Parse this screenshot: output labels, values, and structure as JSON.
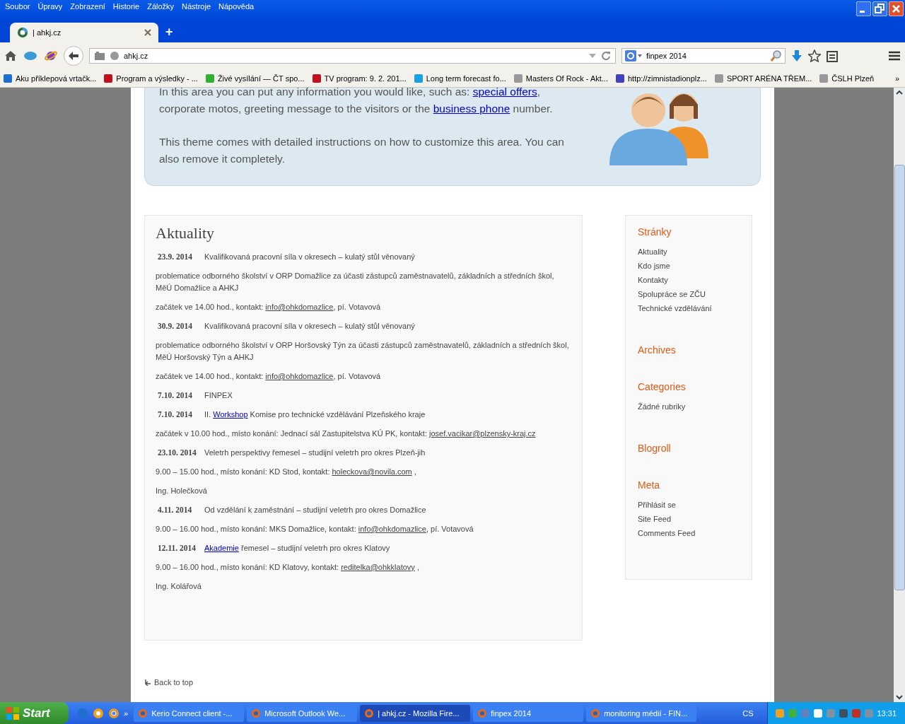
{
  "window": {
    "menu": [
      "Soubor",
      "Úpravy",
      "Zobrazení",
      "Historie",
      "Záložky",
      "Nástroje",
      "Nápověda"
    ]
  },
  "tabs": [
    {
      "title": "| ahkj.cz",
      "selected": true
    }
  ],
  "new_tab": "+",
  "address_bar": {
    "url": "ahkj.cz"
  },
  "search": {
    "value": "finpex 2014"
  },
  "bookmarks": [
    "Aku příklepová vrtačk...",
    "Program a výsledky - ...",
    "Živé vysílání — ČT spo...",
    "TV program: 9. 2. 201...",
    "Long term forecast fo...",
    "Masters Of Rock - Akt...",
    "http://zimnistadionplz...",
    "SPORT ARÉNA TŘEM...",
    "ČSLH Plzeň"
  ],
  "bookmarks_more": "»",
  "info_box": {
    "paragraphs": [
      [
        {
          "kind": "text",
          "text": "In this area you can put any information you would like, such as: "
        },
        {
          "kind": "link",
          "text": "special offers"
        },
        {
          "kind": "text",
          "text": ", corporate motos, greeting message to the visitors or the "
        },
        {
          "kind": "link",
          "text": "business phone"
        },
        {
          "kind": "text",
          "text": " number."
        }
      ],
      [
        {
          "kind": "text",
          "text": "This theme comes with detailed instructions on how to customize this area. You can also remove it completely."
        }
      ]
    ]
  },
  "news": {
    "title": "Aktuality",
    "lines": [
      [
        {
          "kind": "date",
          "text": "23.9. 2014"
        },
        {
          "kind": "text",
          "text": "Kvalifikovaná pracovní síla v okresech – kulatý stůl věnovaný"
        }
      ],
      [
        {
          "kind": "text",
          "text": "problematice odborného školství v ORP Domažlice za účasti zástupců zaměstnavatelů, základních a středních škol, MěÚ Domažlice a AHKJ"
        }
      ],
      [
        {
          "kind": "text",
          "text": "začátek ve 14.00 hod., kontakt: "
        },
        {
          "kind": "email",
          "text": "info@ohkdomazlice"
        },
        {
          "kind": "text",
          "text": ", pí. Votavová"
        }
      ],
      [
        {
          "kind": "date",
          "text": "30.9. 2014"
        },
        {
          "kind": "text",
          "text": "Kvalifikovaná pracovní síla v okresech – kulatý stůl věnovaný"
        }
      ],
      [
        {
          "kind": "text",
          "text": "problematice odborného školství v ORP Horšovský Týn za účasti zástupců zaměstnavatelů, základních a středních škol, MěÚ Horšovský Týn a AHKJ"
        }
      ],
      [
        {
          "kind": "text",
          "text": "začátek ve 14.00 hod., kontakt: "
        },
        {
          "kind": "email",
          "text": "info@ohkdomazlice"
        },
        {
          "kind": "text",
          "text": ", pí. Votavová"
        }
      ],
      [
        {
          "kind": "date",
          "text": "7.10. 2014"
        },
        {
          "kind": "text",
          "text": "FINPEX"
        }
      ],
      [
        {
          "kind": "date",
          "text": "7.10. 2014"
        },
        {
          "kind": "text",
          "text": "II. "
        },
        {
          "kind": "link",
          "text": "Workshop"
        },
        {
          "kind": "text",
          "text": " Komise pro technické vzdělávání Plzeňského kraje"
        }
      ],
      [
        {
          "kind": "text",
          "text": "začátek v 10.00 hod., místo konání: Jednací sál Zastupitelstva KÚ PK, kontakt: "
        },
        {
          "kind": "email",
          "text": "josef.vacikar@plzensky-kraj.cz"
        }
      ],
      [
        {
          "kind": "date",
          "text": "23.10. 2014"
        },
        {
          "kind": "text",
          "text": "Veletrh perspektivy řemesel – studijní veletrh pro okres Plzeň-jih"
        }
      ],
      [
        {
          "kind": "text",
          "text": "9.00 – 15.00 hod., místo konání: KD Stod, kontakt: "
        },
        {
          "kind": "email",
          "text": "holeckova@novila.com"
        },
        {
          "kind": "text",
          "text": " ,"
        }
      ],
      [
        {
          "kind": "text",
          "text": "Ing. Holečková"
        }
      ],
      [
        {
          "kind": "date",
          "text": "4.11. 2014"
        },
        {
          "kind": "text",
          "text": "Od vzdělání k zaměstnání – studijní veletrh pro okres Domažlice"
        }
      ],
      [
        {
          "kind": "text",
          "text": "9.00 – 16.00 hod., místo konání: MKS Domažlice, kontakt: "
        },
        {
          "kind": "email",
          "text": "info@ohkdomazlice"
        },
        {
          "kind": "text",
          "text": ", pí. Votavová"
        }
      ],
      [
        {
          "kind": "date",
          "text": "12.11. 2014"
        },
        {
          "kind": "link",
          "text": "Akademie"
        },
        {
          "kind": "text",
          "text": " řemesel – studijní veletrh pro okres Klatovy"
        }
      ],
      [
        {
          "kind": "text",
          "text": "9.00 – 16.00 hod., místo konání: KD Klatovy, kontakt: "
        },
        {
          "kind": "email",
          "text": "reditelka@ohkklatovy"
        },
        {
          "kind": "text",
          "text": " ,"
        }
      ],
      [
        {
          "kind": "text",
          "text": "Ing. Kolářová"
        }
      ]
    ]
  },
  "sidebar": [
    {
      "title": "Stránky",
      "items": [
        "Aktuality",
        "Kdo jsme",
        "Kontakty",
        "Spolupráce se ZČU",
        "Technické vzdělávání"
      ]
    },
    {
      "title": "Archives"
    },
    {
      "title": "Categories",
      "items": [
        "Žádné rubriky"
      ]
    },
    {
      "title": "Blogroll"
    },
    {
      "title": "Meta",
      "items": [
        "Přihlásit se",
        "Site Feed",
        "Comments Feed"
      ]
    }
  ],
  "back_to_top": "Back to top",
  "taskbar": {
    "start": "Start",
    "tasks": [
      {
        "label": "Kerio Connect client -...",
        "selected": false
      },
      {
        "label": "Microsoft Outlook We...",
        "selected": false
      },
      {
        "label": "| ahkj.cz - Mozilla Fire...",
        "selected": true
      },
      {
        "label": "finpex 2014",
        "selected": false
      },
      {
        "label": "monitoring médií - FIN...",
        "selected": false
      }
    ],
    "quick_launch_more": "»",
    "language": "CS",
    "clock": "13:31"
  }
}
